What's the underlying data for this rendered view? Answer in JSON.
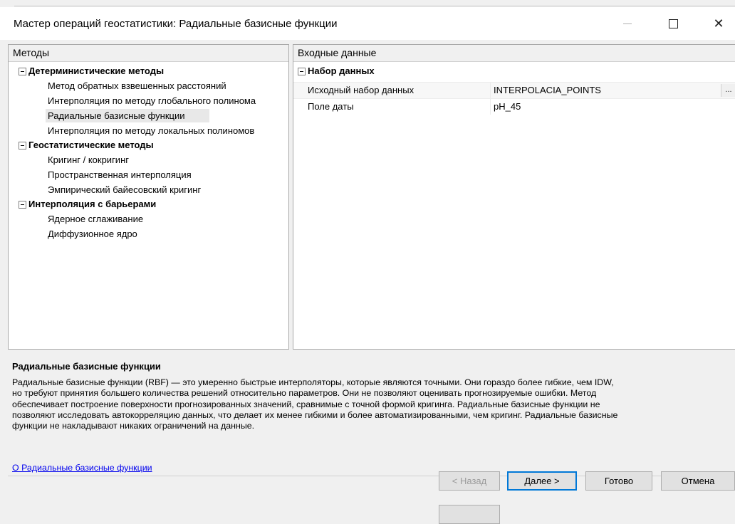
{
  "window": {
    "title": "Мастер операций геостатистики: Радиальные базисные функции",
    "minimize_icon": "minimize-icon",
    "maximize_icon": "maximize-icon",
    "close_icon": "close-icon",
    "close_glyph": "✕"
  },
  "methods": {
    "header": "Методы",
    "groups": [
      {
        "label": "Детерминистические методы",
        "items": [
          "Метод обратных взвешенных расстояний",
          "Интерполяция по методу глобального полинома",
          "Радиальные базисные функции",
          "Интерполяция по методу локальных полиномов"
        ]
      },
      {
        "label": "Геостатистические методы",
        "items": [
          "Кригинг / кокригинг",
          "Пространственная интерполяция",
          "Эмпирический байесовский кригинг"
        ]
      },
      {
        "label": "Интерполяция с барьерами",
        "items": [
          "Ядерное сглаживание",
          "Диффузионное ядро"
        ]
      }
    ],
    "selected": "Радиальные базисные функции"
  },
  "input": {
    "header": "Входные данные",
    "section": "Набор данных",
    "rows": [
      {
        "name": "Исходный набор данных",
        "value": "INTERPOLACIA_POINTS",
        "button": "..."
      },
      {
        "name": "Поле даты",
        "value": "pH_45"
      }
    ]
  },
  "description": {
    "title": "Радиальные базисные функции",
    "lines": [
      "Радиальные базисные функции (RBF) — это умеренно быстрые интерполяторы, которые являются точными. Они гораздо более гибкие, чем IDW,",
      "но требуют принятия большего количества решений относительно параметров. Они не позволяют оценивать прогнозируемые ошибки. Метод",
      "обеспечивает построение поверхности прогнозированных значений, сравнимые с точной формой кригинга. Радиальные базисные функции не",
      "позволяют исследовать автокорреляцию данных, что делает их менее гибкими и более автоматизированными, чем кригинг. Радиальные базисные",
      "функции не накладывают никаких ограничений на данные."
    ],
    "link": "О Радиальные базисные функции"
  },
  "buttons": {
    "back": "< Назад",
    "next": "Далее >",
    "finish": "Готово",
    "cancel": "Отмена"
  }
}
